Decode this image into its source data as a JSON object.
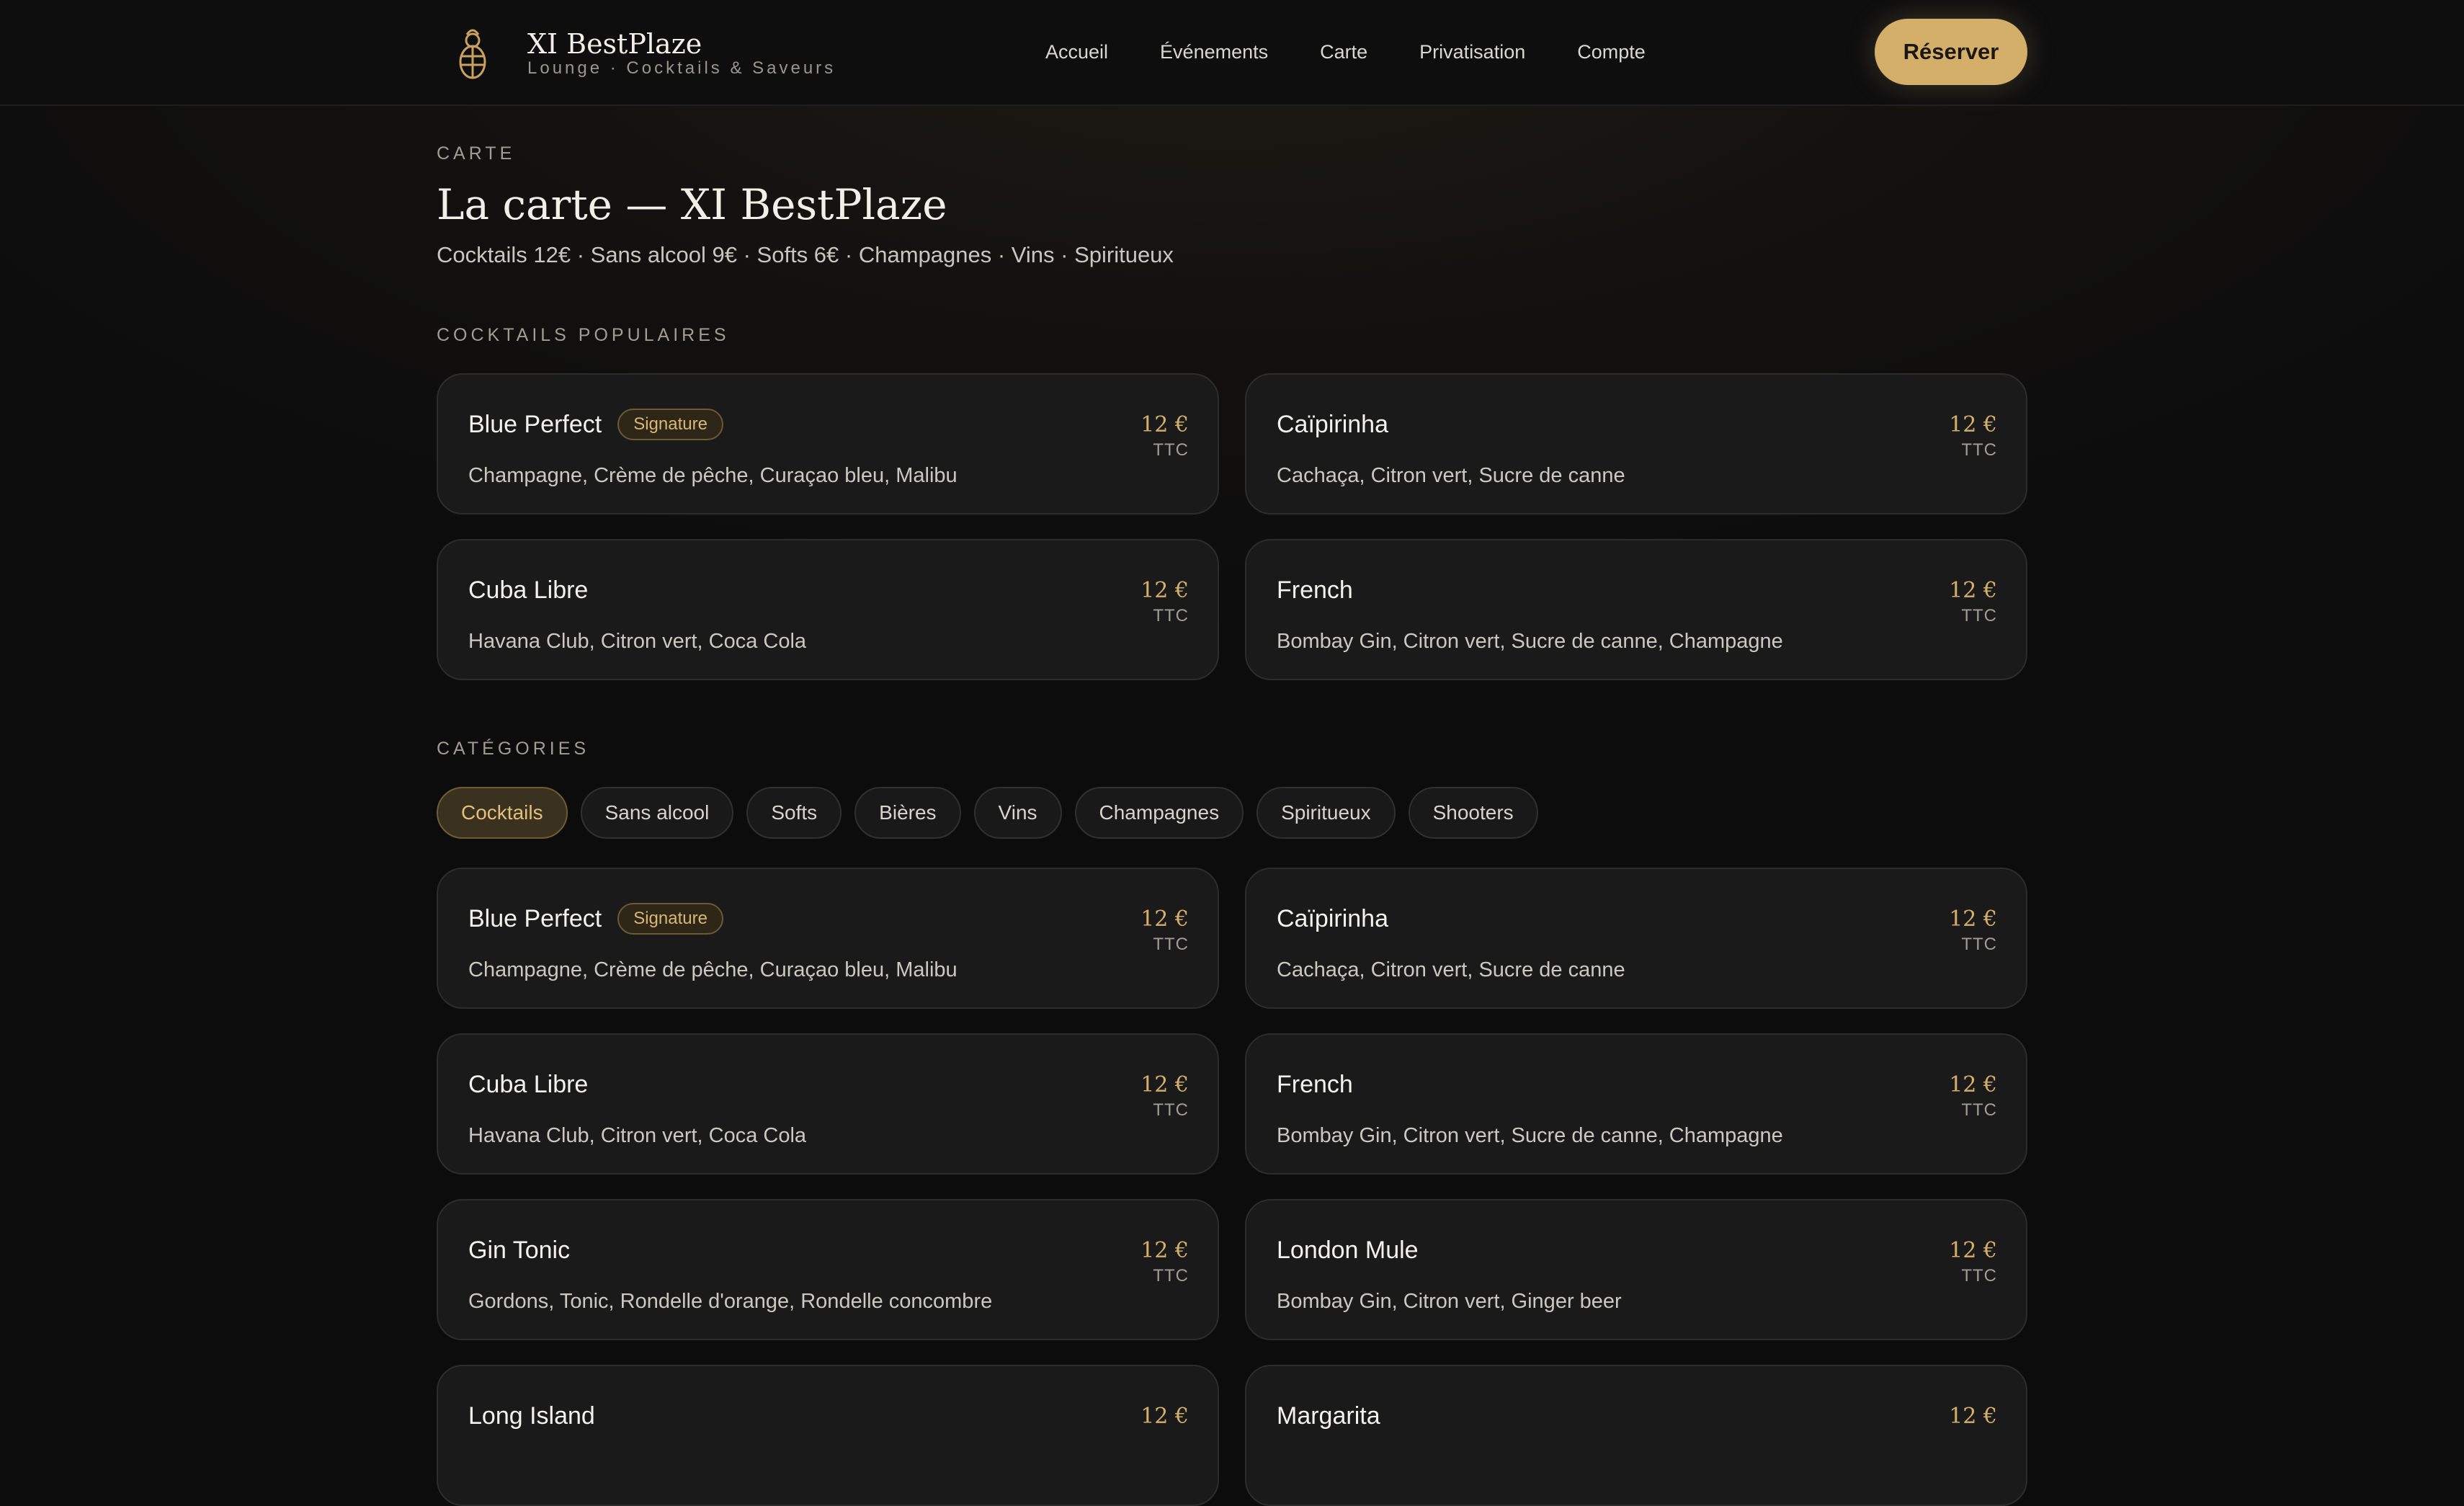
{
  "brand": {
    "name": "XI BestPlaze",
    "tagline": "Lounge · Cocktails & Saveurs",
    "accent": "#d4af6a"
  },
  "nav": {
    "items": [
      "Accueil",
      "Événements",
      "Carte",
      "Privatisation",
      "Compte"
    ],
    "reserve_label": "Réserver"
  },
  "page": {
    "eyebrow": "CARTE",
    "title": "La carte — XI BestPlaze",
    "subtitle": "Cocktails 12€ · Sans alcool 9€ · Softs 6€ · Champagnes · Vins · Spiritueux"
  },
  "popular": {
    "label": "COCKTAILS POPULAIRES",
    "items": [
      {
        "name": "Blue Perfect",
        "badge": "Signature",
        "desc": "Champagne, Crème de pêche, Curaçao bleu, Malibu",
        "price": "12 €",
        "ttc": "TTC"
      },
      {
        "name": "Caïpirinha",
        "desc": "Cachaça, Citron vert, Sucre de canne",
        "price": "12 €",
        "ttc": "TTC"
      },
      {
        "name": "Cuba Libre",
        "desc": "Havana Club, Citron vert, Coca Cola",
        "price": "12 €",
        "ttc": "TTC"
      },
      {
        "name": "French",
        "desc": "Bombay Gin, Citron vert, Sucre de canne, Champagne",
        "price": "12 €",
        "ttc": "TTC"
      }
    ]
  },
  "categories": {
    "label": "CATÉGORIES",
    "chips": [
      "Cocktails",
      "Sans alcool",
      "Softs",
      "Bières",
      "Vins",
      "Champagnes",
      "Spiritueux",
      "Shooters"
    ],
    "active": "Cocktails"
  },
  "menu": {
    "items": [
      {
        "name": "Blue Perfect",
        "badge": "Signature",
        "desc": "Champagne, Crème de pêche, Curaçao bleu, Malibu",
        "price": "12 €",
        "ttc": "TTC"
      },
      {
        "name": "Caïpirinha",
        "desc": "Cachaça, Citron vert, Sucre de canne",
        "price": "12 €",
        "ttc": "TTC"
      },
      {
        "name": "Cuba Libre",
        "desc": "Havana Club, Citron vert, Coca Cola",
        "price": "12 €",
        "ttc": "TTC"
      },
      {
        "name": "French",
        "desc": "Bombay Gin, Citron vert, Sucre de canne, Champagne",
        "price": "12 €",
        "ttc": "TTC"
      },
      {
        "name": "Gin Tonic",
        "desc": "Gordons, Tonic, Rondelle d'orange, Rondelle concombre",
        "price": "12 €",
        "ttc": "TTC"
      },
      {
        "name": "London Mule",
        "desc": "Bombay Gin, Citron vert, Ginger beer",
        "price": "12 €",
        "ttc": "TTC"
      },
      {
        "name": "Long Island",
        "desc": "",
        "price": "12 €",
        "ttc": ""
      },
      {
        "name": "Margarita",
        "desc": "",
        "price": "12 €",
        "ttc": ""
      }
    ]
  }
}
